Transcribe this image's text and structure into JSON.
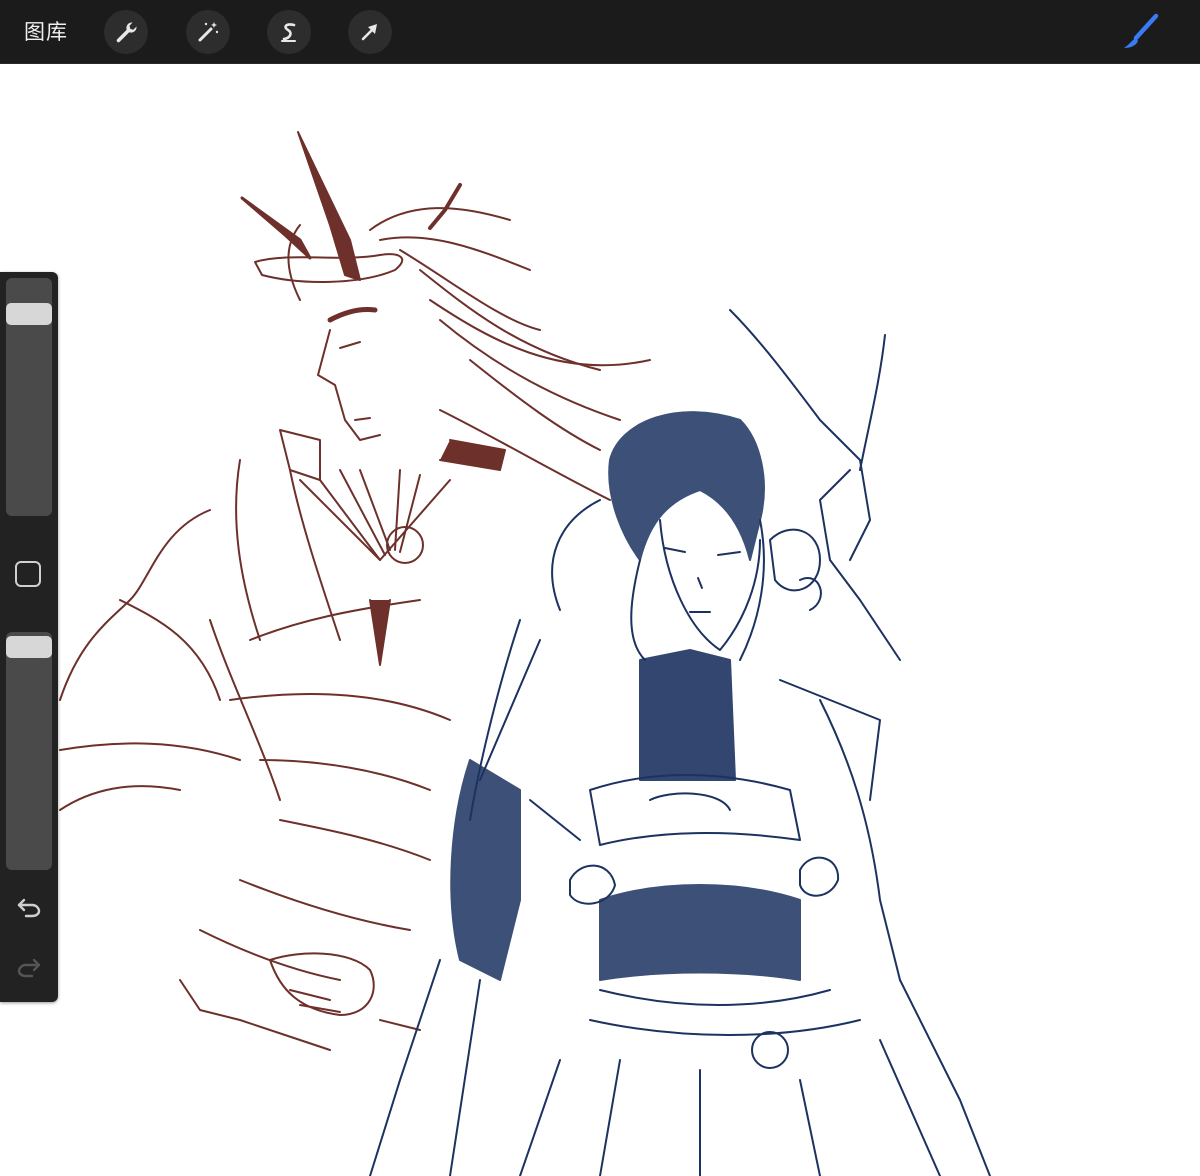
{
  "toolbar": {
    "gallery_label": "图库",
    "tools": [
      "wrench-icon",
      "magic-wand-icon",
      "selection-icon",
      "transform-arrow-icon"
    ],
    "active_tool": "brush-icon",
    "accent_color": "#3a7bf5"
  },
  "sidebar": {
    "brush_size_level": 0.1,
    "brush_opacity_level": 0.0,
    "buttons": [
      "modify-square-icon",
      "undo-icon",
      "redo-icon"
    ],
    "redo_enabled": false
  },
  "canvas": {
    "background": "#ffffff",
    "stroke_colors": [
      "#5e1a14",
      "#1c3260"
    ]
  }
}
